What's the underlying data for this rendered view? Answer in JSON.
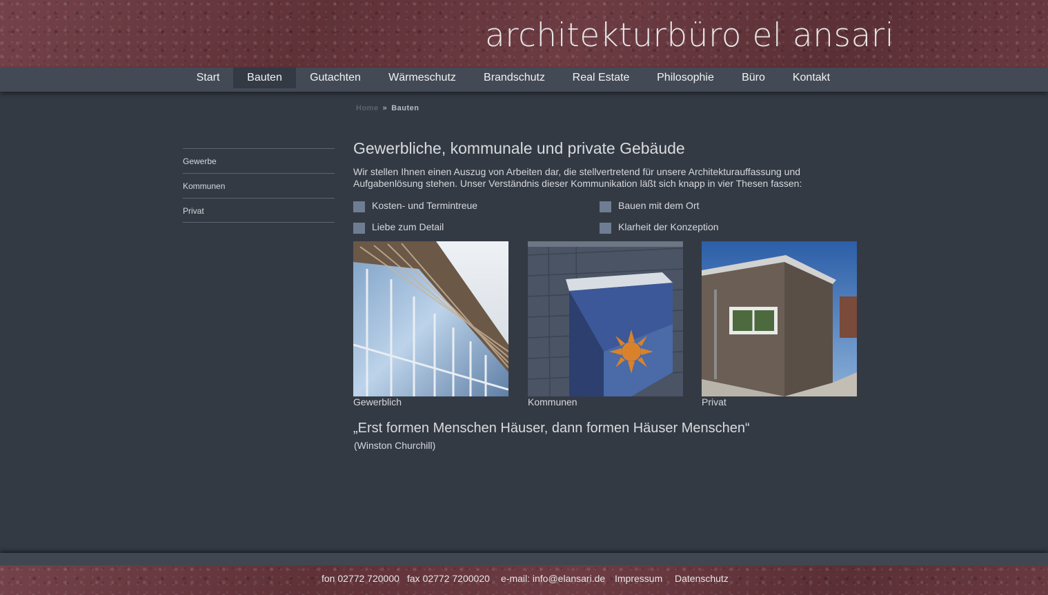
{
  "header": {
    "logo_text": "architekturbüro el ansari"
  },
  "nav": {
    "items": [
      {
        "label": "Start"
      },
      {
        "label": "Bauten"
      },
      {
        "label": "Gutachten"
      },
      {
        "label": "Wärmeschutz"
      },
      {
        "label": "Brandschutz"
      },
      {
        "label": "Real Estate"
      },
      {
        "label": "Philosophie"
      },
      {
        "label": "Büro"
      },
      {
        "label": "Kontakt"
      }
    ],
    "active": "Bauten"
  },
  "breadcrumb": {
    "home": "Home",
    "separator": "»",
    "current": "Bauten"
  },
  "sidebar": {
    "items": [
      {
        "label": "Gewerbe"
      },
      {
        "label": "Kommunen"
      },
      {
        "label": "Privat"
      }
    ]
  },
  "main": {
    "title": "Gewerbliche, kommunale und private Gebäude",
    "intro": "Wir stellen Ihnen einen Auszug von Arbeiten dar, die stellvertretend für unsere Architekturauffassung und Aufgabenlösung stehen. Unser Verständnis dieser Kommunikation läßt sich knapp in vier Thesen fassen:",
    "theses": [
      "Kosten- und Termintreue",
      "Bauen mit dem Ort",
      "Liebe zum Detail",
      "Klarheit der Konzeption"
    ],
    "gallery": [
      {
        "caption": "Gewerblich"
      },
      {
        "caption": "Kommunen"
      },
      {
        "caption": "Privat"
      }
    ],
    "quote": "„Erst formen Menschen Häuser, dann formen Häuser Menschen“",
    "quote_author": "(Winston Churchill)"
  },
  "footer": {
    "phone": "fon 02772  720000",
    "fax": "fax 02772  7200020",
    "email": "e-mail: info@elansari.de",
    "impressum": "Impressum",
    "datenschutz": "Datenschutz"
  },
  "colors": {
    "background": "#343a44",
    "navbar": "#434a55",
    "bullet": "#6f7d92",
    "granite": "#6b3a40"
  }
}
